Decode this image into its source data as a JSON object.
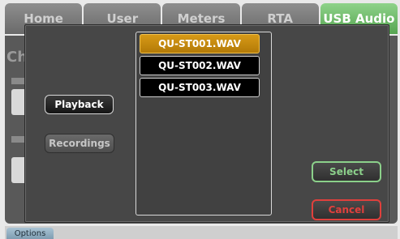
{
  "background": {
    "tabs": [
      "Home",
      "User",
      "Meters",
      "RTA",
      "USB Audio"
    ],
    "active_tab": "USB Audio",
    "panel_text": "Ch",
    "footer_tab": "Options"
  },
  "dialog": {
    "mode_buttons": {
      "playback_label": "Playback",
      "recordings_label": "Recordings"
    },
    "files": [
      {
        "name": "QU-ST001.WAV",
        "selected": true
      },
      {
        "name": "QU-ST002.WAV",
        "selected": false
      },
      {
        "name": "QU-ST003.WAV",
        "selected": false
      }
    ],
    "select_label": "Select",
    "cancel_label": "Cancel"
  },
  "colors": {
    "selected_file": "#c88a0f",
    "select_button": "#8bd08a",
    "cancel_button": "#e0403c",
    "active_tab": "#6fbf6a"
  }
}
